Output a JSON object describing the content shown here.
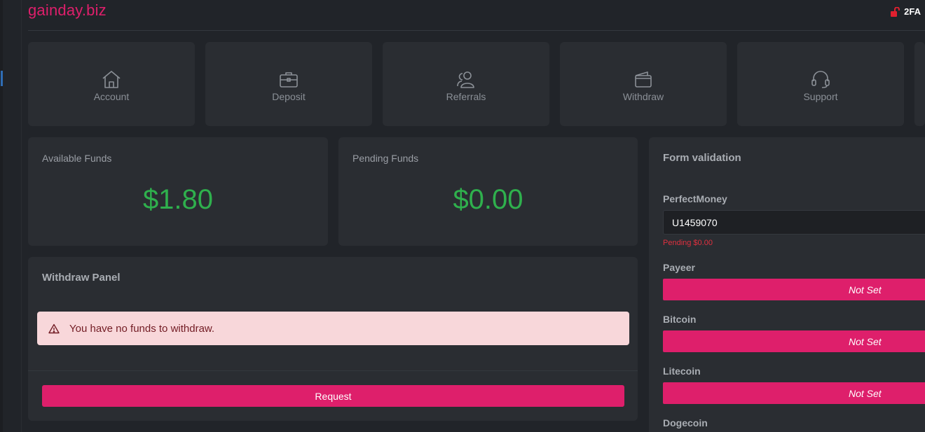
{
  "brand": "gainday.biz",
  "header": {
    "twofa_label": "2FA",
    "lock_icon": "unlocked-lock-icon",
    "lock_color": "#e0202f"
  },
  "tiles": [
    {
      "label": "Account",
      "icon": "home-icon"
    },
    {
      "label": "Deposit",
      "icon": "briefcase-icon"
    },
    {
      "label": "Referrals",
      "icon": "users-icon"
    },
    {
      "label": "Withdraw",
      "icon": "wallet-icon"
    },
    {
      "label": "Support",
      "icon": "headset-icon"
    }
  ],
  "funds": {
    "available": {
      "label": "Available Funds",
      "amount": "$1.80"
    },
    "pending": {
      "label": "Pending Funds",
      "amount": "$0.00"
    }
  },
  "withdraw_panel": {
    "title": "Withdraw Panel",
    "alert_text": "You have no funds to withdraw.",
    "alert_icon": "warning-triangle-icon",
    "request_label": "Request"
  },
  "form_validation": {
    "title": "Form validation",
    "perfectmoney": {
      "label": "PerfectMoney",
      "value": "U1459070",
      "pending": "Pending $0.00"
    },
    "payeer": {
      "label": "Payeer",
      "button": "Not Set"
    },
    "bitcoin": {
      "label": "Bitcoin",
      "button": "Not Set"
    },
    "litecoin": {
      "label": "Litecoin",
      "button": "Not Set"
    },
    "dogecoin": {
      "label": "Dogecoin"
    }
  },
  "colors": {
    "accent": "#de1f6b",
    "amount_green": "#2fb04d",
    "alert_bg": "#f8d7da",
    "alert_text": "#721c24",
    "pending_red": "#e0303f"
  }
}
